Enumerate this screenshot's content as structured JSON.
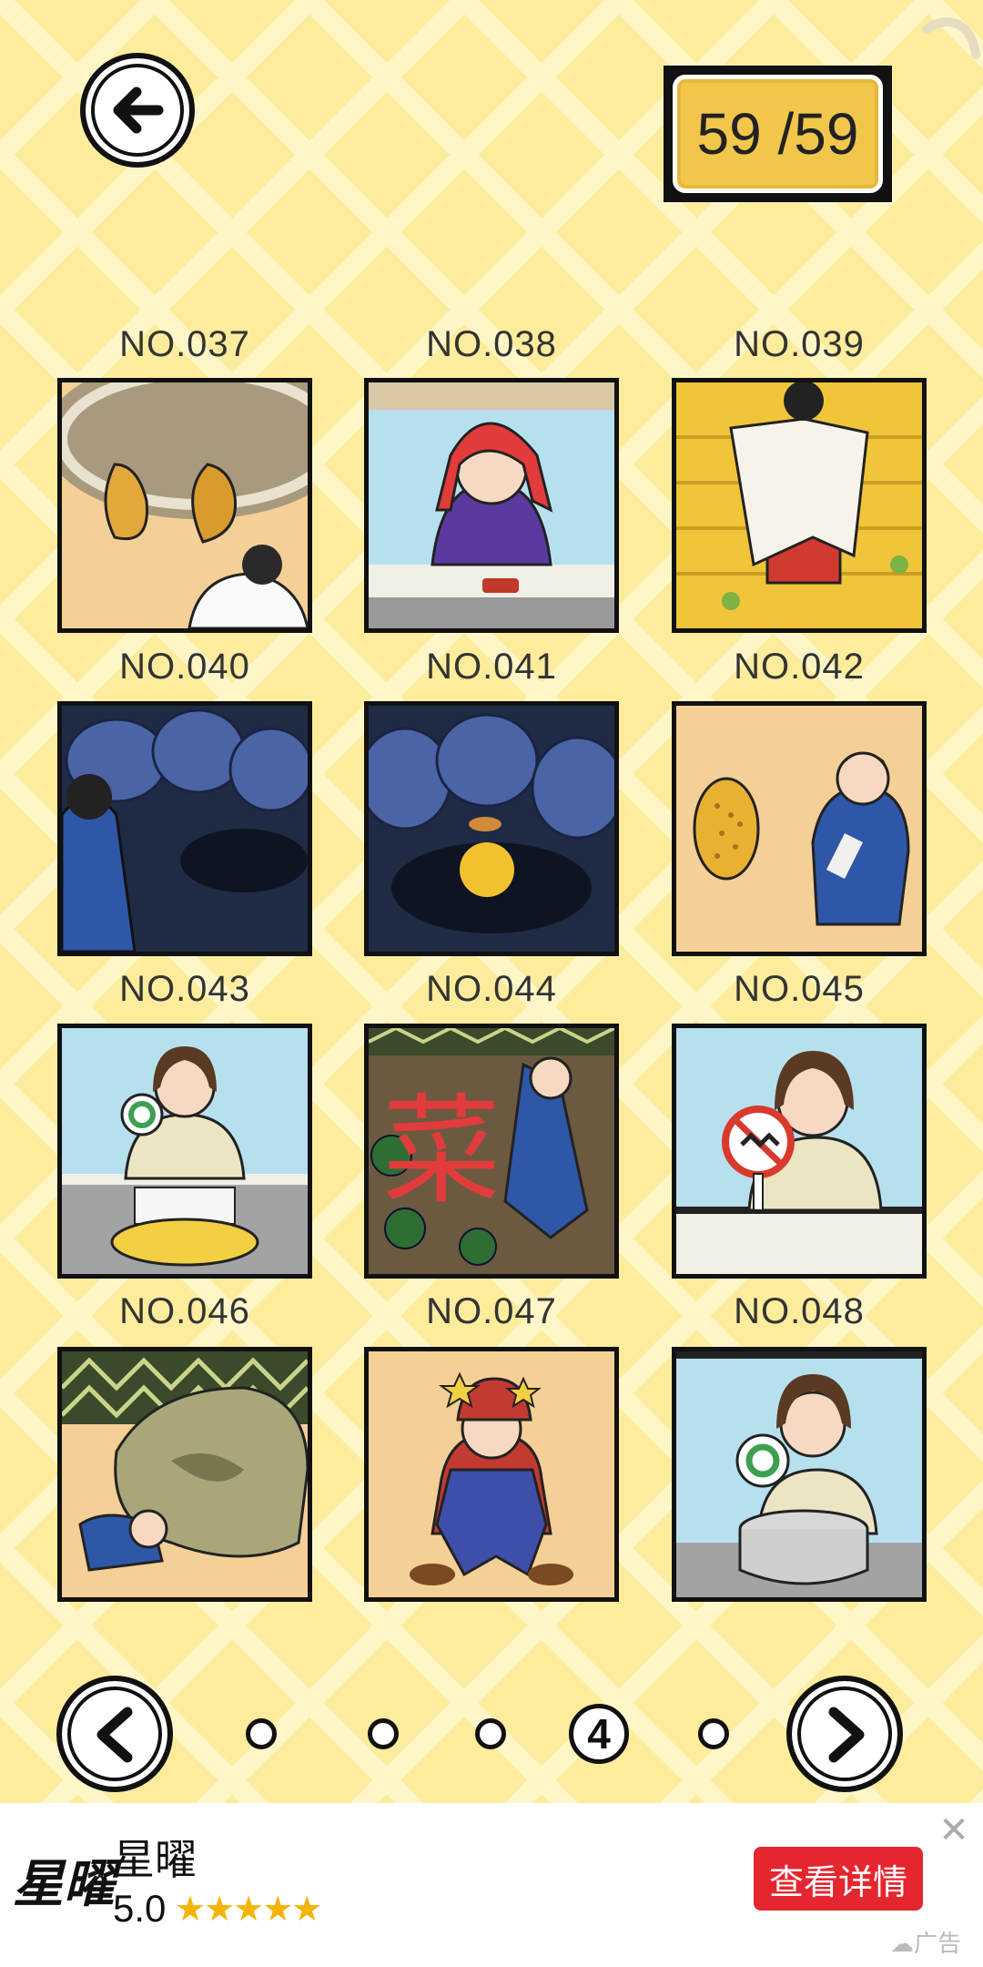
{
  "progress": {
    "text": "59 /59"
  },
  "levels": [
    {
      "label": "NO.037"
    },
    {
      "label": "NO.038"
    },
    {
      "label": "NO.039"
    },
    {
      "label": "NO.040"
    },
    {
      "label": "NO.041"
    },
    {
      "label": "NO.042"
    },
    {
      "label": "NO.043"
    },
    {
      "label": "NO.044"
    },
    {
      "label": "NO.045"
    },
    {
      "label": "NO.046"
    },
    {
      "label": "NO.047"
    },
    {
      "label": "NO.048"
    }
  ],
  "pager": {
    "current_page": "4",
    "page_count": 5
  },
  "ad": {
    "logo": "星曜",
    "title": "星曜",
    "rating": "5.0",
    "stars": "★★★★★",
    "cta": "查看详情",
    "close": "✕",
    "tag": "☁广告"
  },
  "colors": {
    "background": "#fcec9c",
    "progress_fill": "#f2c64a",
    "cta": "#e5262f",
    "stars": "#f4b400"
  }
}
